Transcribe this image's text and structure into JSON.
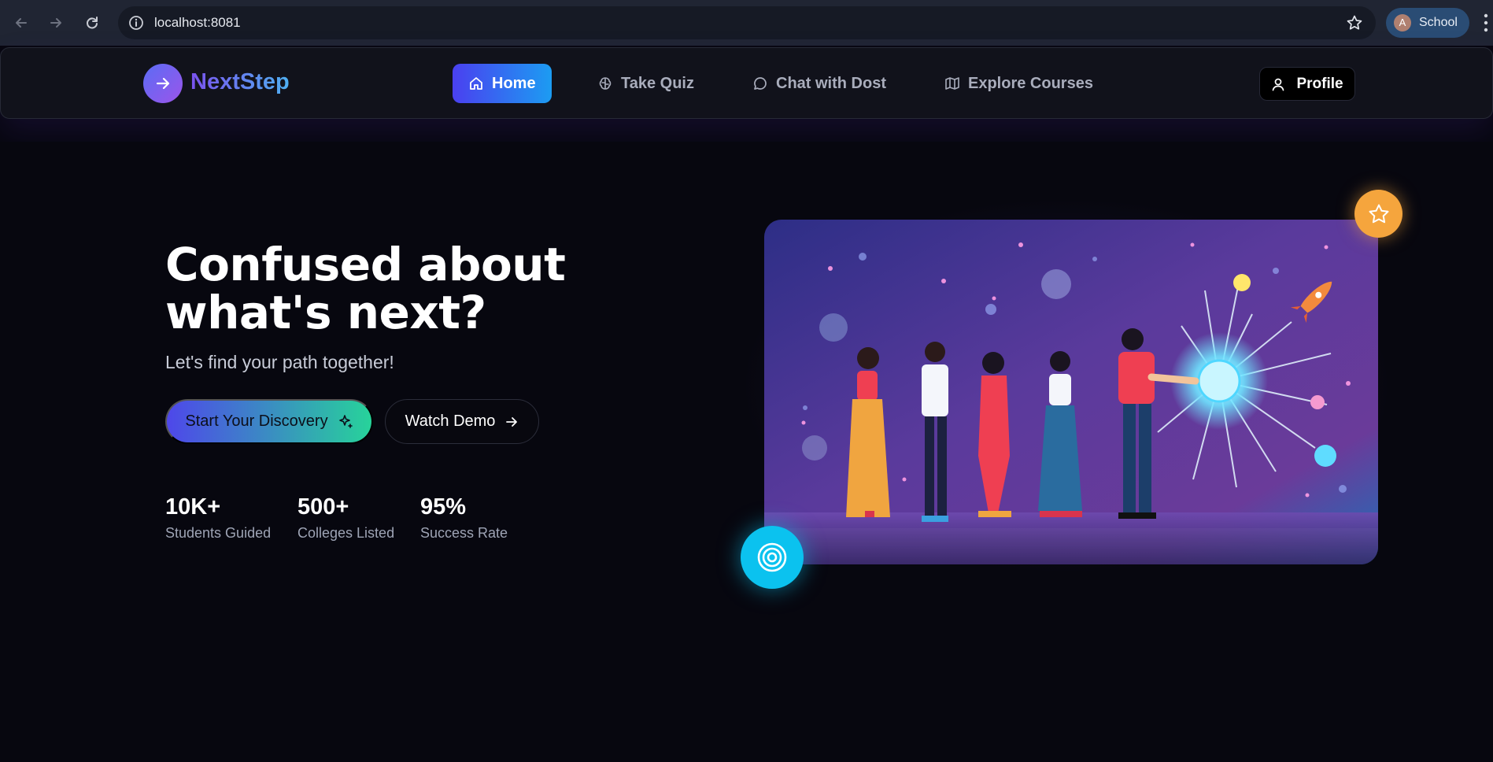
{
  "browser": {
    "url": "localhost:8081",
    "profile_initial": "A",
    "profile_name": "School"
  },
  "navbar": {
    "logo_text": "NextStep",
    "items": [
      {
        "label": "Home",
        "icon": "home-icon",
        "active": true
      },
      {
        "label": "Take Quiz",
        "icon": "brain-icon",
        "active": false
      },
      {
        "label": "Chat with Dost",
        "icon": "chat-bubble-icon",
        "active": false
      },
      {
        "label": "Explore Courses",
        "icon": "map-icon",
        "active": false
      }
    ],
    "profile_label": "Profile"
  },
  "hero": {
    "title_line1": "Confused about",
    "title_line2": "what's next?",
    "subtitle": "Let's find your path together!",
    "primary_cta": "Start Your Discovery",
    "secondary_cta": "Watch Demo",
    "stats": [
      {
        "value": "10K+",
        "label": "Students Guided"
      },
      {
        "value": "500+",
        "label": "Colleges Listed"
      },
      {
        "value": "95%",
        "label": "Success Rate"
      }
    ]
  },
  "colors": {
    "background": "#07070f",
    "accent_purple": "#4e47ea",
    "accent_green": "#27d39a",
    "accent_blue": "#1c9cf2",
    "star_badge": "#f5a53d",
    "target_badge": "#0bc2ef"
  }
}
